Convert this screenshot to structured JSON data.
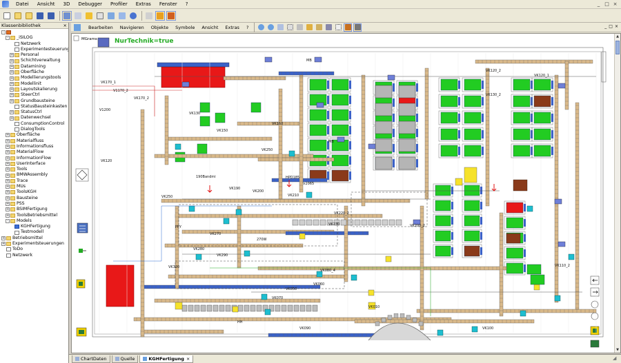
{
  "menubar": {
    "items": [
      "Datei",
      "Ansicht",
      "3D",
      "Debugger",
      "Profiler",
      "Extras",
      "Fenster",
      "?"
    ]
  },
  "window_controls": [
    "_",
    "□",
    "×"
  ],
  "left_panel": {
    "title": "Klassenbibliothek",
    "close": "×",
    "tree": [
      {
        "label": "",
        "indent": 0,
        "exp": "-",
        "icon": "root"
      },
      {
        "label": "_iSILOG",
        "indent": 1,
        "exp": "-",
        "icon": "folder"
      },
      {
        "label": "Netzwerk",
        "indent": 2,
        "exp": "",
        "icon": "doc"
      },
      {
        "label": "Experimentesteuerung",
        "indent": 2,
        "exp": "",
        "icon": "doc"
      },
      {
        "label": "Personal",
        "indent": 2,
        "exp": "+",
        "icon": "folder"
      },
      {
        "label": "Schichtverwaltung",
        "indent": 2,
        "exp": "+",
        "icon": "folder"
      },
      {
        "label": "Datamining",
        "indent": 2,
        "exp": "+",
        "icon": "folder"
      },
      {
        "label": "Oberfläche",
        "indent": 2,
        "exp": "+",
        "icon": "folder"
      },
      {
        "label": "Modellierungstools",
        "indent": 2,
        "exp": "+",
        "icon": "folder"
      },
      {
        "label": "Modellinit",
        "indent": 2,
        "exp": "+",
        "icon": "folder"
      },
      {
        "label": "Layoutskalierung",
        "indent": 2,
        "exp": "+",
        "icon": "folder"
      },
      {
        "label": "SteerCtrl",
        "indent": 2,
        "exp": "+",
        "icon": "folder"
      },
      {
        "label": "Grundbausteine",
        "indent": 2,
        "exp": "+",
        "icon": "folder"
      },
      {
        "label": "StatusBausteinkasten",
        "indent": 2,
        "exp": "",
        "icon": "doc"
      },
      {
        "label": "StatusCtrl",
        "indent": 2,
        "exp": "+",
        "icon": "folder"
      },
      {
        "label": "Datenwechsel",
        "indent": 2,
        "exp": "+",
        "icon": "folder"
      },
      {
        "label": "ConsumptionControl",
        "indent": 2,
        "exp": "",
        "icon": "doc"
      },
      {
        "label": "DialogTools",
        "indent": 2,
        "exp": "",
        "icon": "doc"
      },
      {
        "label": "Oberfläche",
        "indent": 1,
        "exp": "+",
        "icon": "folder"
      },
      {
        "label": "Materialfluss",
        "indent": 1,
        "exp": "+",
        "icon": "folder"
      },
      {
        "label": "Informationsfluss",
        "indent": 1,
        "exp": "+",
        "icon": "folder"
      },
      {
        "label": "MaterialFlow",
        "indent": 1,
        "exp": "+",
        "icon": "folder"
      },
      {
        "label": "InformationFlow",
        "indent": 1,
        "exp": "+",
        "icon": "folder"
      },
      {
        "label": "UserInterface",
        "indent": 1,
        "exp": "+",
        "icon": "folder"
      },
      {
        "label": "Tools",
        "indent": 1,
        "exp": "+",
        "icon": "folder"
      },
      {
        "label": "BMWAssembly",
        "indent": 1,
        "exp": "+",
        "icon": "folder"
      },
      {
        "label": "Trace",
        "indent": 1,
        "exp": "+",
        "icon": "folder"
      },
      {
        "label": "MUs",
        "indent": 1,
        "exp": "+",
        "icon": "folder"
      },
      {
        "label": "ToolsKGH",
        "indent": 1,
        "exp": "+",
        "icon": "folder"
      },
      {
        "label": "Bausteine",
        "indent": 1,
        "exp": "+",
        "icon": "folder"
      },
      {
        "label": "PSS",
        "indent": 1,
        "exp": "+",
        "icon": "folder"
      },
      {
        "label": "BSIMFertigung",
        "indent": 1,
        "exp": "+",
        "icon": "folder"
      },
      {
        "label": "ToolsBetriebsmittel",
        "indent": 1,
        "exp": "+",
        "icon": "folder"
      },
      {
        "label": "Models",
        "indent": 1,
        "exp": "-",
        "icon": "folder"
      },
      {
        "label": "KGHFertigung",
        "indent": 2,
        "exp": "",
        "icon": "sel"
      },
      {
        "label": "Testmodell",
        "indent": 2,
        "exp": "",
        "icon": "doc"
      },
      {
        "label": "Betriebsmittel",
        "indent": 0,
        "exp": "+",
        "icon": "folder"
      },
      {
        "label": "Experimentsteuerungen",
        "indent": 0,
        "exp": "+",
        "icon": "folder"
      },
      {
        "label": "ToDo",
        "indent": 0,
        "exp": "",
        "icon": "doc"
      },
      {
        "label": "Netzwerk",
        "indent": 0,
        "exp": "",
        "icon": "doc"
      }
    ]
  },
  "inner_window": {
    "menu": [
      "Bearbeiten",
      "Navigieren",
      "Objekte",
      "Symbole",
      "Ansicht",
      "Extras",
      "?"
    ],
    "controls": [
      "_",
      "□",
      "×"
    ]
  },
  "canvas": {
    "mg_label": "MGrams",
    "condition_label": "NurTechnik=true",
    "labels": [
      {
        "id": "l1",
        "text": "VK170_1"
      },
      {
        "id": "l2",
        "text": "V1170_2"
      },
      {
        "id": "l3",
        "text": "VK170_2"
      },
      {
        "id": "l4",
        "text": "V1200"
      },
      {
        "id": "l5",
        "text": "VK150"
      },
      {
        "id": "l6",
        "text": "VK120"
      },
      {
        "id": "l7",
        "text": "VK130"
      },
      {
        "id": "l8",
        "text": "VK250"
      },
      {
        "id": "l9",
        "text": "VK160"
      },
      {
        "id": "l10",
        "text": "V2065"
      },
      {
        "id": "l11",
        "text": "HPD185"
      },
      {
        "id": "l12",
        "text": "190Bandmi"
      },
      {
        "id": "l13",
        "text": "VK190"
      },
      {
        "id": "l14",
        "text": "VK200"
      },
      {
        "id": "l15",
        "text": "VK210"
      },
      {
        "id": "l16",
        "text": "VK220_2"
      },
      {
        "id": "l17",
        "text": "VK230"
      },
      {
        "id": "l18",
        "text": "VK250"
      },
      {
        "id": "l19",
        "text": "VK270"
      },
      {
        "id": "l20",
        "text": "270W"
      },
      {
        "id": "l21",
        "text": "VK280"
      },
      {
        "id": "l22",
        "text": "VK290"
      },
      {
        "id": "l23",
        "text": "VK320"
      },
      {
        "id": "l24",
        "text": "VK080_4"
      },
      {
        "id": "l25",
        "text": "VK050"
      },
      {
        "id": "l26",
        "text": "VK070"
      },
      {
        "id": "l27",
        "text": "VK060"
      },
      {
        "id": "l28",
        "text": "VK010"
      },
      {
        "id": "l29",
        "text": "VK090"
      },
      {
        "id": "l30",
        "text": "VK100"
      },
      {
        "id": "l31",
        "text": "VK110_2"
      },
      {
        "id": "l32",
        "text": "VK120_1"
      },
      {
        "id": "l33",
        "text": "VK120_2"
      },
      {
        "id": "l34",
        "text": "VK130_2"
      },
      {
        "id": "l35",
        "text": "MB"
      },
      {
        "id": "l36",
        "text": "MB"
      },
      {
        "id": "l37",
        "text": "PFY"
      },
      {
        "id": "l38",
        "text": "HH"
      },
      {
        "id": "l39",
        "text": "VK200_2"
      }
    ]
  },
  "bottom_tabs": [
    {
      "label": "ChartDaten",
      "active": false
    },
    {
      "label": "Quelle",
      "active": false
    },
    {
      "label": "KGHFertigung",
      "active": true,
      "close": "×"
    }
  ]
}
